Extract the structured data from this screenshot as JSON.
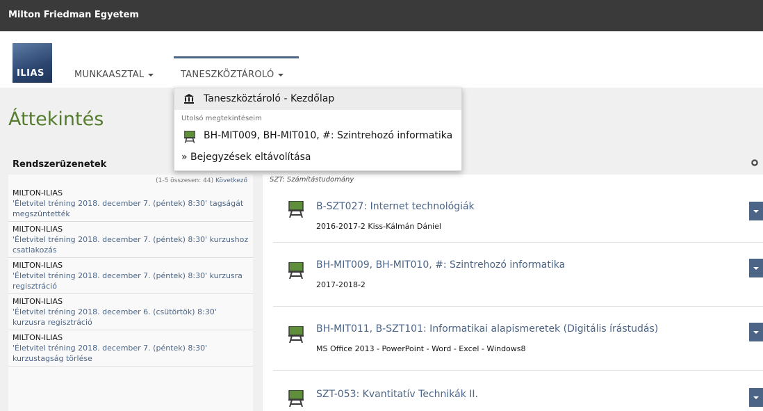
{
  "topbar": {
    "institution": "Milton Friedman Egyetem"
  },
  "logo": {
    "text": "ILIAS"
  },
  "mainmenu": {
    "workspace": "MUNKAASZTAL",
    "repository": "TANESZKÖZTÁROLÓ"
  },
  "page": {
    "title": "Áttekintés"
  },
  "dropdown": {
    "home": "Taneszköztároló - Kezdőlap",
    "section_label": "Utolsó megtekintéseim",
    "recent_item": "BH-MIT009, BH-MIT010, #: Szintrehozó informatika",
    "remove": "» Bejegyzések eltávolítása"
  },
  "system_messages": {
    "header": "Rendszerüzenetek",
    "pager_text": "(1-5 összesen: 44)",
    "pager_next": "Következő",
    "items": [
      {
        "source": "MILTON-ILIAS",
        "text": "'Életvitel tréning 2018. december 7. (péntek) 8:30' tagságát megszüntették"
      },
      {
        "source": "MILTON-ILIAS",
        "text": "'Életvitel tréning 2018. december 7. (péntek) 8:30' kurzushoz csatlakozás"
      },
      {
        "source": "MILTON-ILIAS",
        "text": "'Életvitel tréning 2018. december 7. (péntek) 8:30' kurzusra regisztráció"
      },
      {
        "source": "MILTON-ILIAS",
        "text": "'Életvitel tréning 2018. december 6. (csütörtök) 8:30' kurzusra regisztráció"
      },
      {
        "source": "MILTON-ILIAS",
        "text": "'Életvitel tréning 2018. december 7. (péntek) 8:30' kurzustagság törlése"
      }
    ]
  },
  "courses": {
    "category": "SZT: Számítástudomány",
    "items": [
      {
        "title": "B-SZT027: Internet technológiák",
        "subtitle": "2016-2017-2 Kiss-Kálmán Dániel"
      },
      {
        "title": "BH-MIT009, BH-MIT010, #: Szintrehozó informatika",
        "subtitle": "2017-2018-2"
      },
      {
        "title": "BH-MIT011, B-SZT101: Informatikai alapismeretek (Digitális írástudás)",
        "subtitle": "MS Office 2013 - PowerPoint - Word - Excel - Windows8"
      },
      {
        "title": "SZT-053: Kvantitatív Technikák II.",
        "subtitle": ""
      }
    ]
  },
  "colors": {
    "accent": "#4c6586",
    "title_green": "#557b2e",
    "topbar": "#3a3a3a"
  }
}
